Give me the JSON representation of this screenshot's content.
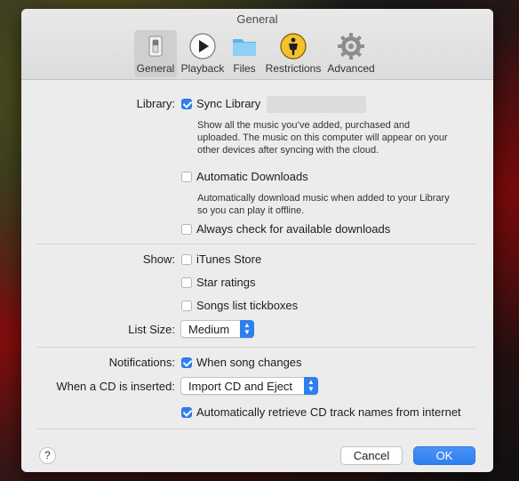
{
  "window": {
    "title": "General"
  },
  "toolbar": {
    "items": [
      {
        "label": "General",
        "icon": "switch-icon",
        "selected": true
      },
      {
        "label": "Playback",
        "icon": "play-icon"
      },
      {
        "label": "Files",
        "icon": "folder-icon"
      },
      {
        "label": "Restrictions",
        "icon": "parental-restrictions-icon"
      },
      {
        "label": "Advanced",
        "icon": "gear-icon"
      }
    ]
  },
  "library": {
    "label": "Library:",
    "sync": {
      "label": "Sync Library",
      "checked": true
    },
    "sync_desc": "Show all the music you’ve added, purchased and uploaded. The music on this computer will appear on your other devices after syncing with the cloud.",
    "auto_downloads": {
      "label": "Automatic Downloads",
      "checked": false
    },
    "auto_desc": "Automatically download music when added to your Library so you can play it offline.",
    "always_check": {
      "label": "Always check for available downloads",
      "checked": false
    }
  },
  "show": {
    "label": "Show:",
    "itunes_store": {
      "label": "iTunes Store",
      "checked": false
    },
    "star_ratings": {
      "label": "Star ratings",
      "checked": false
    },
    "tickboxes": {
      "label": "Songs list tickboxes",
      "checked": false
    }
  },
  "list_size": {
    "label": "List Size:",
    "value": "Medium"
  },
  "notifications": {
    "label": "Notifications:",
    "song_changes": {
      "label": "When song changes",
      "checked": true
    }
  },
  "cd": {
    "label": "When a CD is inserted:",
    "value": "Import CD and Eject",
    "retrieve": {
      "label": "Automatically retrieve CD track names from internet",
      "checked": true
    }
  },
  "buttons": {
    "help": "?",
    "cancel": "Cancel",
    "ok": "OK"
  },
  "colors": {
    "accent": "#2f7ff0",
    "window_bg": "#ececec"
  }
}
